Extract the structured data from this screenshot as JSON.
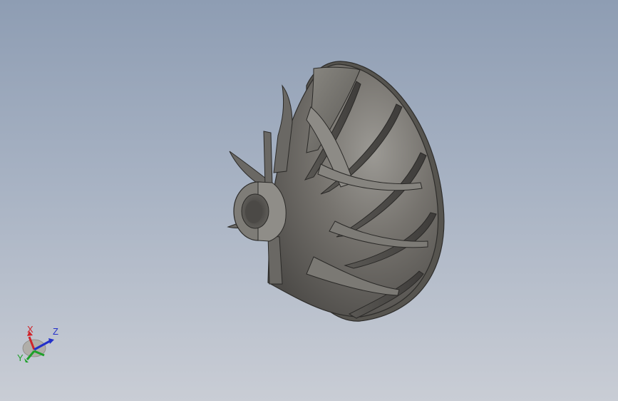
{
  "viewport": {
    "background_top": "#8e9db3",
    "background_bottom": "#c9cdd5"
  },
  "model": {
    "name": "compressor-impeller",
    "color": "#6f6d69"
  },
  "triad": {
    "x_label": "X",
    "y_label": "Y",
    "z_label": "Z",
    "x_color": "#d0242a",
    "y_color": "#1fa02b",
    "z_color": "#2330c9"
  }
}
